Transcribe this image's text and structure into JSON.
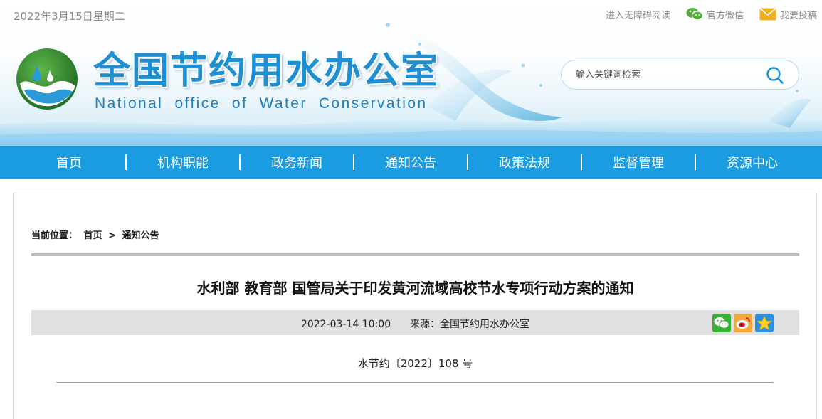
{
  "header": {
    "date": "2022年3月15日星期二",
    "links": {
      "accessibility": "进入无障碍阅读",
      "wechat": "官方微信",
      "submit": "我要投稿"
    },
    "site_title": "全国节约用水办公室",
    "site_subtitle": "National office of Water Conservation",
    "search": {
      "placeholder": "输入关键词检索"
    }
  },
  "nav": {
    "items": [
      "首页",
      "机构职能",
      "政务新闻",
      "通知公告",
      "政策法规",
      "监督管理",
      "资源中心"
    ]
  },
  "breadcrumb": {
    "label": "当前位置：",
    "home": "首页",
    "separator": ">",
    "current": "通知公告"
  },
  "article": {
    "title": "水利部 教育部 国管局关于印发黄河流域高校节水专项行动方案的通知",
    "datetime": "2022-03-14 10:00",
    "source": "来源：全国节约用水办公室",
    "doc_number": "水节约〔2022〕108 号"
  },
  "colors": {
    "nav_bg": "#1b9be0",
    "title_blue": "#1f8fd3",
    "logo_green": "#2e8a32"
  },
  "icons": [
    "wechat-icon",
    "mail-icon",
    "search-icon",
    "wechat-share-icon",
    "weibo-share-icon",
    "qzone-share-icon"
  ]
}
